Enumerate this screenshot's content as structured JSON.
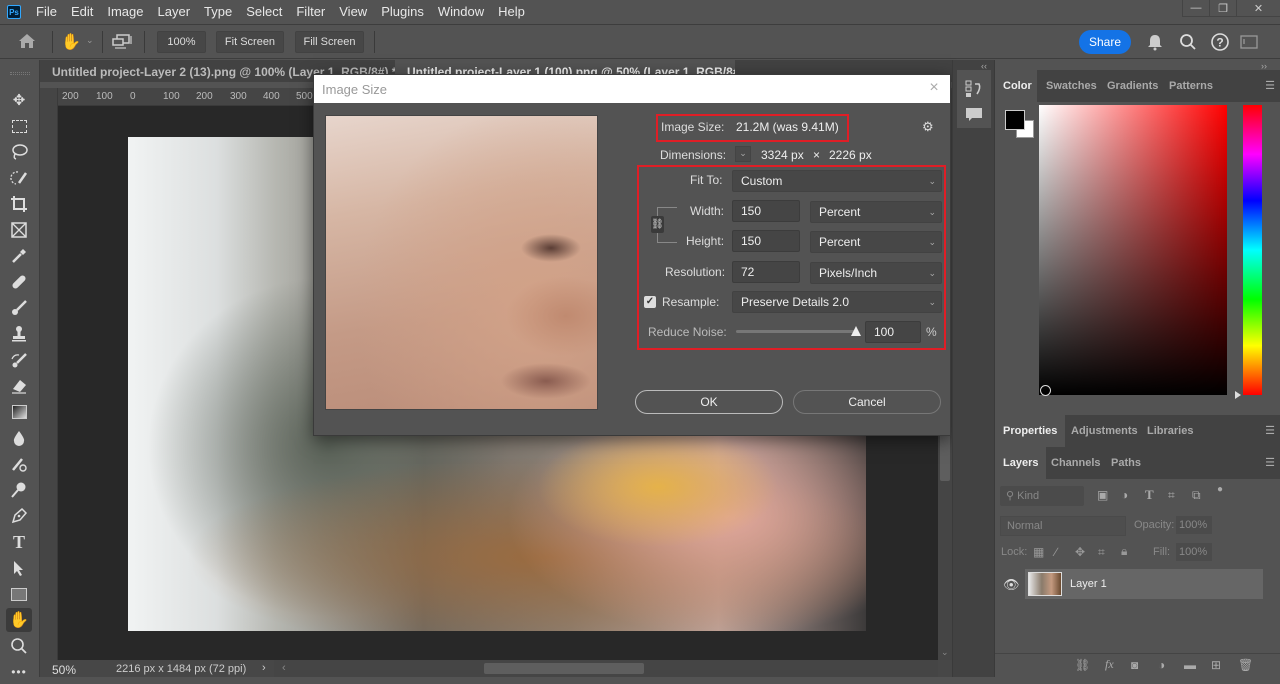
{
  "app": {
    "logo_text": "Ps",
    "menu": [
      "File",
      "Edit",
      "Image",
      "Layer",
      "Type",
      "Select",
      "Filter",
      "View",
      "Plugins",
      "Window",
      "Help"
    ],
    "window_controls": {
      "minimize": "—",
      "restore": "❐",
      "close": "✕"
    }
  },
  "options_bar": {
    "zoom_btn": "100%",
    "fit_screen": "Fit Screen",
    "fill_screen": "Fill Screen",
    "share": "Share"
  },
  "tabs": [
    {
      "label": "Untitled project-Layer 2 (13).png @ 100% (Layer 1, RGB/8#) *",
      "close": "×",
      "active": false
    },
    {
      "label": "Untitled project-Layer 1 (100).png @ 50% (Layer 1, RGB/8#)",
      "close": "×",
      "active": true
    }
  ],
  "ruler": {
    "top_ticks": [
      "200",
      "100",
      "0",
      "100",
      "200",
      "300",
      "400",
      "500"
    ]
  },
  "status_bar": {
    "zoom": "50%",
    "doc_info": "2216 px x 1484 px (72 ppi)",
    "arrow": "›",
    "left_arrow": "‹"
  },
  "dialog": {
    "title": "Image Size",
    "close": "×",
    "image_size_label": "Image Size:",
    "image_size_value": "21.2M (was 9.41M)",
    "dimensions_label": "Dimensions:",
    "dimensions_width": "3324 px",
    "dimensions_x": "×",
    "dimensions_height": "2226 px",
    "fit_to_label": "Fit To:",
    "fit_to_value": "Custom",
    "width_label": "Width:",
    "width_value": "150",
    "width_unit": "Percent",
    "height_label": "Height:",
    "height_value": "150",
    "height_unit": "Percent",
    "resolution_label": "Resolution:",
    "resolution_value": "72",
    "resolution_unit": "Pixels/Inch",
    "resample_label": "Resample:",
    "resample_checked": true,
    "resample_value": "Preserve Details 2.0",
    "reduce_noise_label": "Reduce Noise:",
    "reduce_noise_value": "100",
    "reduce_noise_fraction": 1.0,
    "percent_sign": "%",
    "ok": "OK",
    "cancel": "Cancel"
  },
  "color_panel": {
    "tabs": [
      "Color",
      "Swatches",
      "Gradients",
      "Patterns"
    ],
    "active_tab": "Color",
    "foreground": "#000000",
    "background": "#ffffff",
    "hue": "#ff0000"
  },
  "properties_panel": {
    "tabs": [
      "Properties",
      "Adjustments",
      "Libraries"
    ],
    "active_tab": "Properties"
  },
  "layers_panel": {
    "tabs": [
      "Layers",
      "Channels",
      "Paths"
    ],
    "active_tab": "Layers",
    "filter_placeholder": "Kind",
    "blend_mode": "Normal",
    "opacity_label": "Opacity:",
    "opacity_value": "100%",
    "lock_label": "Lock:",
    "fill_label": "Fill:",
    "fill_value": "100%",
    "layers": [
      {
        "name": "Layer 1",
        "visible": true
      }
    ]
  },
  "accent_colors": {
    "highlight_box": "#e01e26",
    "share_button": "#1473e6"
  }
}
